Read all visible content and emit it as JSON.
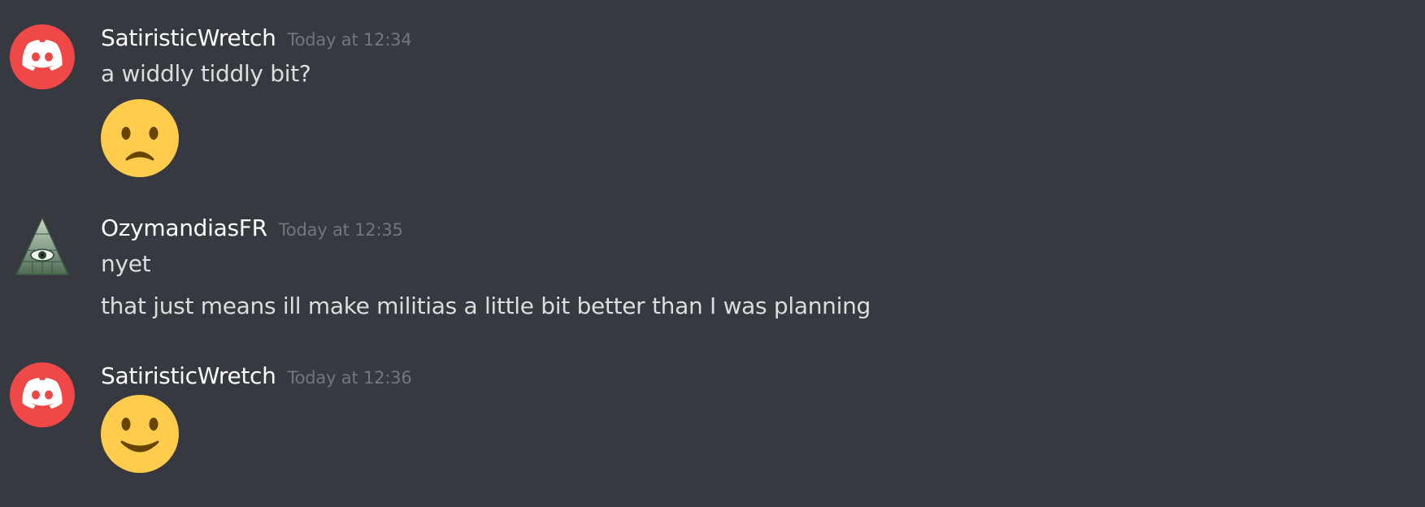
{
  "messages": [
    {
      "username": "SatiristicWretch",
      "timestamp": "Today at 12:34",
      "avatar": "discord-logo-icon",
      "lines": [
        "a widdly tiddly bit?"
      ],
      "emoji": "frowning-face-icon"
    },
    {
      "username": "OzymandiasFR",
      "timestamp": "Today at 12:35",
      "avatar": "illuminati-pyramid-icon",
      "lines": [
        "nyet",
        "that just means ill make militias a little bit better than I was planning"
      ]
    },
    {
      "username": "SatiristicWretch",
      "timestamp": "Today at 12:36",
      "avatar": "discord-logo-icon",
      "emoji": "slightly-smiling-face-icon"
    }
  ],
  "colors": {
    "background": "#36393f",
    "username": "#ffffff",
    "timestamp": "#72767d",
    "message_text": "#dcddde",
    "discord_avatar": "#f04747",
    "emoji_face": "#ffcc4d",
    "emoji_features": "#664500"
  }
}
